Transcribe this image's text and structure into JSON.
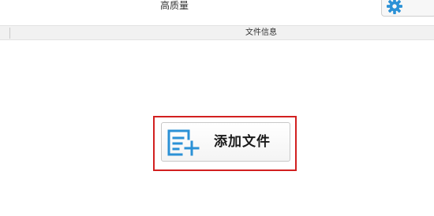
{
  "topbar": {
    "quality_label": "高质量",
    "settings_icon": "gear-icon"
  },
  "table_header": {
    "column_label": "文件信息"
  },
  "main": {
    "add_file_label": "添加文件",
    "add_file_icon": "add-file-icon",
    "highlight_color": "#d22020"
  },
  "colors": {
    "accent": "#2b91d6",
    "header_bg": "#f1f1f1"
  }
}
